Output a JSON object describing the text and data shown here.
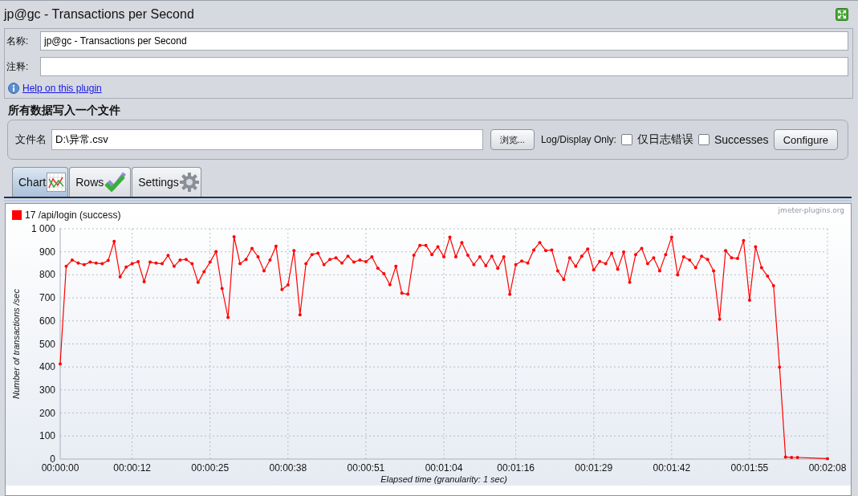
{
  "window": {
    "title": "jp@gc - Transactions per Second"
  },
  "form": {
    "name_label": "名称:",
    "name_value": "jp@gc - Transactions per Second",
    "comment_label": "注释:",
    "help_link": "Help on this plugin"
  },
  "file_section": {
    "heading": "所有数据写入一个文件",
    "file_label": "文件名",
    "file_value": "D:\\异常.csv",
    "browse_button": "浏览...",
    "log_label": "Log/Display Only:",
    "checkboxes": [
      {
        "label": "仅日志错误",
        "checked": false
      },
      {
        "label": "Successes",
        "checked": false
      }
    ],
    "configure_button": "Configure"
  },
  "tabs": [
    {
      "label": "Chart",
      "selected": true
    },
    {
      "label": "Rows",
      "selected": false
    },
    {
      "label": "Settings",
      "selected": false
    }
  ],
  "chart": {
    "credit": "jmeter-plugins.org",
    "chart_data": {
      "type": "line",
      "grid": true,
      "xlabel": "Elapsed time (granularity: 1 sec)",
      "ylabel": "Number of transactions /sec",
      "x": [
        0,
        1,
        2,
        3,
        4,
        5,
        6,
        7,
        8,
        9,
        10,
        11,
        12,
        13,
        14,
        15,
        16,
        17,
        18,
        19,
        20,
        21,
        22,
        23,
        24,
        25,
        26,
        27,
        28,
        29,
        30,
        31,
        32,
        33,
        34,
        35,
        36,
        37,
        38,
        39,
        40,
        41,
        42,
        43,
        44,
        45,
        46,
        47,
        48,
        49,
        50,
        51,
        52,
        53,
        54,
        55,
        56,
        57,
        58,
        59,
        60,
        61,
        62,
        63,
        64,
        65,
        66,
        67,
        68,
        69,
        70,
        71,
        72,
        73,
        74,
        75,
        76,
        77,
        78,
        79,
        80,
        81,
        82,
        83,
        84,
        85,
        86,
        87,
        88,
        89,
        90,
        91,
        92,
        93,
        94,
        95,
        96,
        97,
        98,
        99,
        100,
        101,
        102,
        103,
        104,
        105,
        106,
        107,
        108,
        109,
        110,
        111,
        112,
        113,
        114,
        115,
        116,
        117,
        118,
        119,
        120,
        121,
        122,
        123,
        128
      ],
      "series": [
        {
          "name": "17 /api/login (success)",
          "color": "#ff0000",
          "values": [
            413,
            837,
            864,
            851,
            844,
            855,
            851,
            848,
            862,
            945,
            791,
            834,
            848,
            857,
            770,
            855,
            851,
            848,
            884,
            837,
            864,
            867,
            848,
            767,
            814,
            855,
            901,
            740,
            615,
            965,
            848,
            867,
            915,
            878,
            817,
            864,
            924,
            736,
            756,
            905,
            626,
            848,
            888,
            894,
            844,
            867,
            874,
            851,
            881,
            855,
            864,
            857,
            878,
            828,
            805,
            757,
            837,
            720,
            716,
            885,
            928,
            928,
            888,
            922,
            878,
            963,
            878,
            940,
            885,
            844,
            878,
            840,
            881,
            828,
            878,
            715,
            844,
            860,
            851,
            908,
            940,
            905,
            908,
            817,
            780,
            874,
            837,
            881,
            912,
            821,
            858,
            848,
            894,
            824,
            899,
            767,
            888,
            915,
            848,
            874,
            817,
            888,
            963,
            800,
            878,
            864,
            831,
            881,
            867,
            817,
            607,
            905,
            874,
            871,
            949,
            690,
            922,
            831,
            794,
            753,
            399,
            9,
            7,
            7,
            2
          ]
        }
      ],
      "xlim": [
        0,
        128
      ],
      "ylim": [
        0,
        1000
      ],
      "xticks": [
        {
          "value": 0,
          "label": "00:00:00"
        },
        {
          "value": 12,
          "label": "00:00:12"
        },
        {
          "value": 25,
          "label": "00:00:25"
        },
        {
          "value": 38,
          "label": "00:00:38"
        },
        {
          "value": 51,
          "label": "00:00:51"
        },
        {
          "value": 64,
          "label": "00:01:04"
        },
        {
          "value": 76,
          "label": "00:01:16"
        },
        {
          "value": 89,
          "label": "00:01:29"
        },
        {
          "value": 102,
          "label": "00:01:42"
        },
        {
          "value": 115,
          "label": "00:01:55"
        },
        {
          "value": 128,
          "label": "00:02:08"
        }
      ],
      "yticks": [
        0,
        100,
        200,
        300,
        400,
        500,
        600,
        700,
        800,
        900,
        {
          "value": 1000,
          "label": "1 000"
        }
      ]
    }
  }
}
